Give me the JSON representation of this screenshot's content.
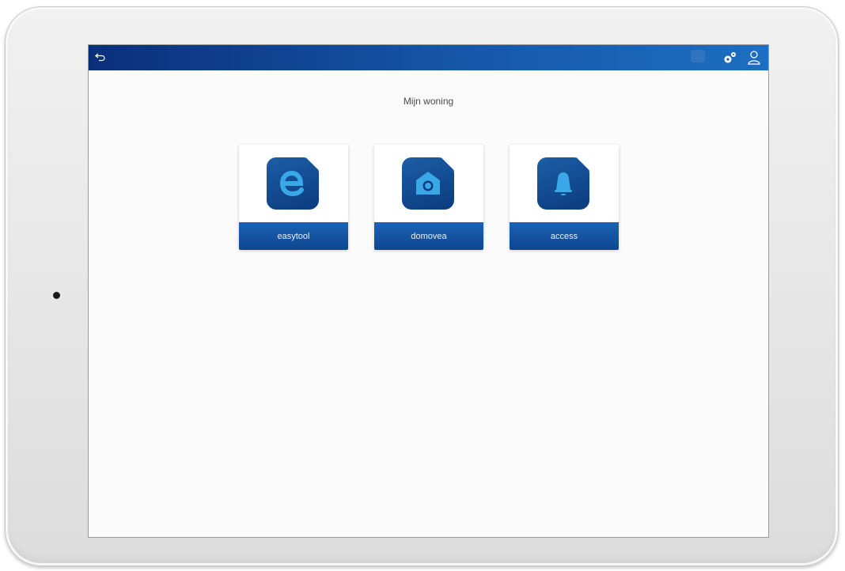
{
  "header": {
    "page_title": "Mijn woning"
  },
  "tiles": [
    {
      "label": "easytool",
      "icon": "e-letter-icon"
    },
    {
      "label": "domovea",
      "icon": "camera-icon"
    },
    {
      "label": "access",
      "icon": "bell-icon"
    }
  ],
  "icons": {
    "back": "back-arrow-icon",
    "status": "status-indicator-icon",
    "settings": "gear-icon",
    "user": "user-icon"
  },
  "colors": {
    "topbar_dark": "#0a2f7a",
    "topbar_light": "#1d6ec1",
    "tile_icon_bg": "#0b3b7e",
    "tile_icon_fg": "#3aa8e6",
    "tile_label_bg": "#1b63b3"
  }
}
